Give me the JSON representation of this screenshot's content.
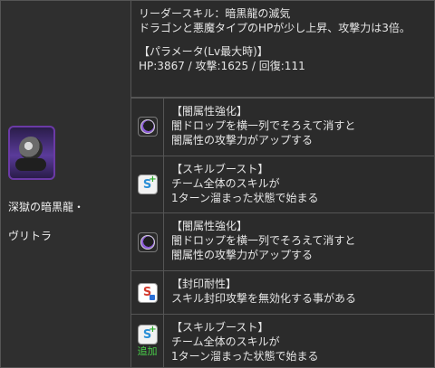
{
  "character": {
    "name_line1": "深獄の暗黒龍・",
    "name_line2": "ヴリトラ",
    "portrait": "dark-dragon-vritra"
  },
  "leader": {
    "title": "リーダースキル：暗黒龍の滅気",
    "desc": "ドラゴンと悪魔タイプのHPが少し上昇、攻撃力は3倍。",
    "params_title": "【パラメータ(Lv最大時)】",
    "params": "HP:3867 / 攻撃:1625 / 回復:111"
  },
  "awakenings": [
    {
      "icon": "dark-attribute-enhance-icon",
      "title": "【闇属性強化】",
      "line1": "闇ドロップを横一列でそろえて消すと",
      "line2": "闇属性の攻撃力がアップする"
    },
    {
      "icon": "skill-boost-icon",
      "title": "【スキルブースト】",
      "line1": "チーム全体のスキルが",
      "line2": "1ターン溜まった状態で始まる"
    },
    {
      "icon": "dark-attribute-enhance-icon",
      "title": "【闇属性強化】",
      "line1": "闇ドロップを横一列でそろえて消すと",
      "line2": "闇属性の攻撃力がアップする"
    },
    {
      "icon": "skill-bind-resist-icon",
      "title": "【封印耐性】",
      "line1": "スキル封印攻撃を無効化する事がある"
    },
    {
      "icon": "skill-boost-icon",
      "title": "【スキルブースト】",
      "line1": "チーム全体のスキルが",
      "line2": "1ターン溜まった状態で始まる",
      "badge": "追加"
    }
  ],
  "colors": {
    "background": "#2b2b2b",
    "border": "#555555",
    "text": "#e6e6e6",
    "dark_accent": "#8b5ad6",
    "added_badge": "#49d049"
  }
}
